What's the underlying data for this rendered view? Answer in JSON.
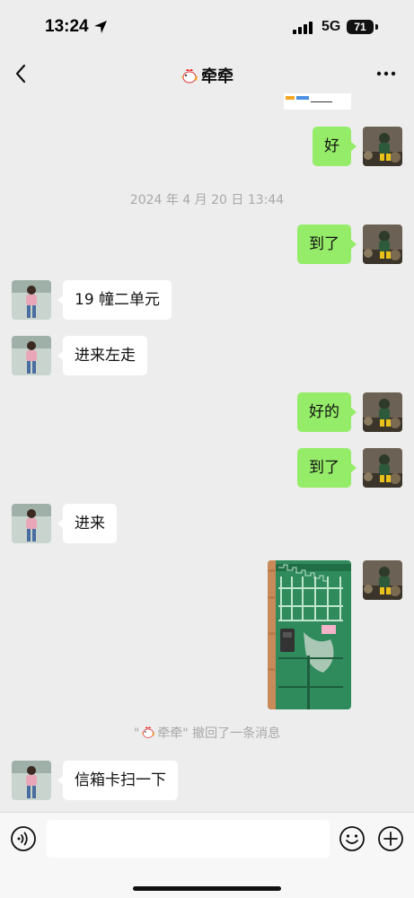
{
  "status_bar": {
    "time": "13:24",
    "network": "5G",
    "battery": "71"
  },
  "chat": {
    "title": "牵牵",
    "contact_icon": "chicken-emoji"
  },
  "messages": [
    {
      "side": "right",
      "text": "好"
    },
    {
      "type": "timestamp",
      "text": "2024 年 4 月 20 日 13:44"
    },
    {
      "side": "right",
      "text": "到了"
    },
    {
      "side": "left",
      "text": "19 幢二单元"
    },
    {
      "side": "left",
      "text": "进来左走"
    },
    {
      "side": "right",
      "text": "好的"
    },
    {
      "side": "right",
      "text": "到了"
    },
    {
      "side": "left",
      "text": "进来"
    },
    {
      "side": "right",
      "type": "image",
      "alt": "green-door-photo"
    },
    {
      "type": "recall",
      "prefix": "\"",
      "name": "牵牵",
      "suffix": "\" 撤回了一条消息"
    },
    {
      "side": "left",
      "text": "信箱卡扫一下"
    }
  ],
  "colors": {
    "sent_bubble": "#95ec69",
    "received_bubble": "#ffffff",
    "background": "#ededed"
  },
  "icons": [
    "back-arrow-icon",
    "more-icon",
    "voice-icon",
    "emoji-icon",
    "add-icon",
    "location-arrow-icon"
  ]
}
